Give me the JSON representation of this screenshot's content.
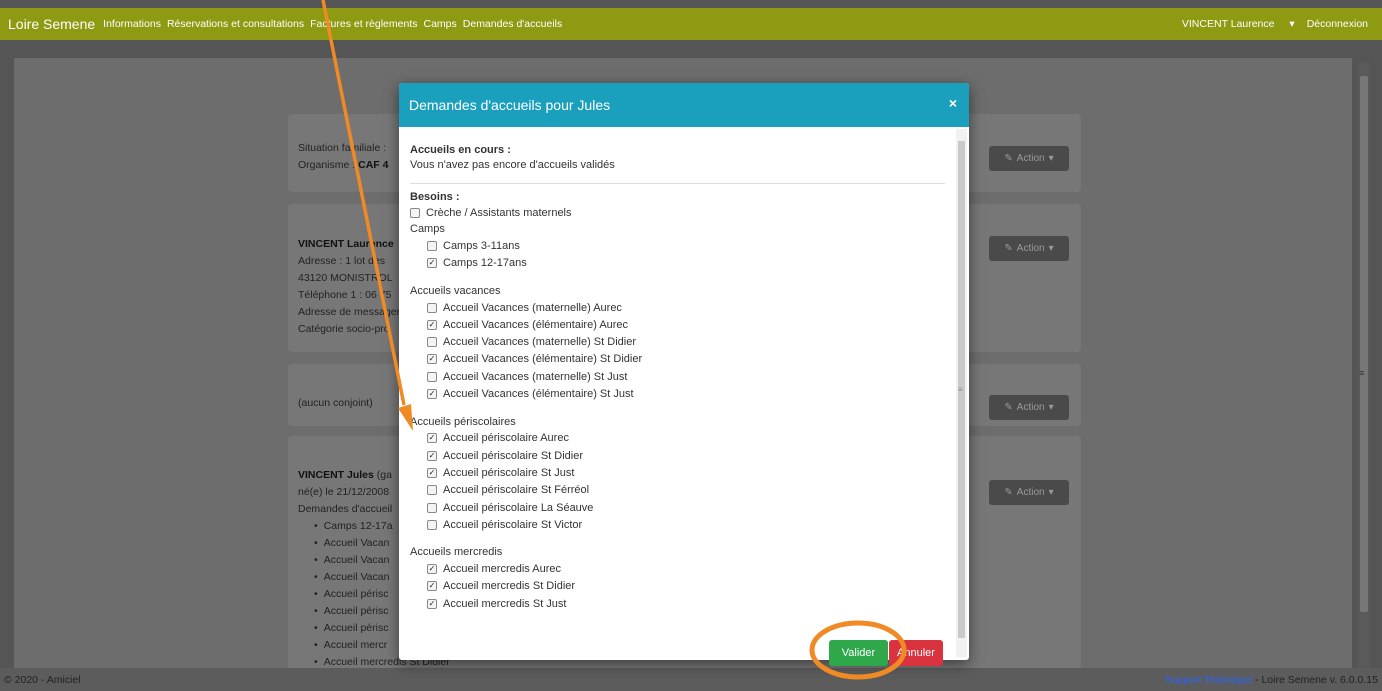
{
  "navbar": {
    "brand": "Loire Semene",
    "links": [
      "Informations",
      "Réservations et consultations",
      "Factures et règlements",
      "Camps",
      "Demandes d'accueils"
    ],
    "user": "VINCENT Laurence",
    "logout": "Déconnexion"
  },
  "background": {
    "card1": {
      "line1": "Situation familiale :",
      "line2_prefix": "Organisme :",
      "line2_value": "CAF 4"
    },
    "card2": {
      "name": "VINCENT Laurence",
      "lines": [
        "Adresse : 1 lot des",
        "43120 MONISTROL",
        "Téléphone 1 : 06 75",
        "Adresse de messagerie",
        "Catégorie socio-pro"
      ]
    },
    "card3": {
      "text": "(aucun conjoint)"
    },
    "card4": {
      "name": "VINCENT Jules",
      "name_suffix": "(ga",
      "line2": "né(e) le 21/12/2008",
      "line3": "Demandes d'accueil",
      "items": [
        "Camps 12-17a",
        "Accueil Vacan",
        "Accueil Vacan",
        "Accueil Vacan",
        "Accueil périsc",
        "Accueil périsc",
        "Accueil périsc",
        "Accueil mercr",
        "Accueil mercredis St Didier"
      ]
    },
    "action_label": "Action"
  },
  "footer": {
    "left": "© 2020 - Amiciel",
    "support": "Support Technique",
    "version": " - Loire Semene v. 6.0.0.15"
  },
  "modal": {
    "title": "Demandes d'accueils pour Jules",
    "close": "×",
    "current_title": "Accueils en cours :",
    "current_text": "Vous n'avez pas encore d'accueils validés",
    "needs_title": "Besoins :",
    "creche": {
      "label": "Crèche / Assistants maternels",
      "checked": false
    },
    "groups": [
      {
        "label": "Camps",
        "items": [
          {
            "label": "Camps 3-11ans",
            "checked": false
          },
          {
            "label": "Camps 12-17ans",
            "checked": true
          }
        ]
      },
      {
        "label": "Accueils vacances",
        "items": [
          {
            "label": "Accueil Vacances (maternelle) Aurec",
            "checked": false
          },
          {
            "label": "Accueil Vacances (élémentaire) Aurec",
            "checked": true
          },
          {
            "label": "Accueil Vacances (maternelle) St Didier",
            "checked": false
          },
          {
            "label": "Accueil Vacances (élémentaire) St Didier",
            "checked": true
          },
          {
            "label": "Accueil Vacances (maternelle) St Just",
            "checked": false
          },
          {
            "label": "Accueil Vacances (élémentaire) St Just",
            "checked": true
          }
        ]
      },
      {
        "label": "Accueils périscolaires",
        "items": [
          {
            "label": "Accueil périscolaire Aurec",
            "checked": true
          },
          {
            "label": "Accueil périscolaire St Didier",
            "checked": true
          },
          {
            "label": "Accueil périscolaire St Just",
            "checked": true
          },
          {
            "label": "Accueil périscolaire St Férréol",
            "checked": false
          },
          {
            "label": "Accueil périscolaire La Séauve",
            "checked": false
          },
          {
            "label": "Accueil périscolaire St Victor",
            "checked": false
          }
        ]
      },
      {
        "label": "Accueils mercredis",
        "items": [
          {
            "label": "Accueil mercredis Aurec",
            "checked": true
          },
          {
            "label": "Accueil mercredis St Didier",
            "checked": true
          },
          {
            "label": "Accueil mercredis St Just",
            "checked": true
          }
        ]
      }
    ],
    "valider": "Valider",
    "annuler": "Annuler"
  },
  "colors": {
    "navbar": "#8d9a12",
    "modal_header": "#1aa0bc",
    "valider": "#2ea84a",
    "annuler": "#d9333f",
    "annotation": "#f08a24"
  }
}
